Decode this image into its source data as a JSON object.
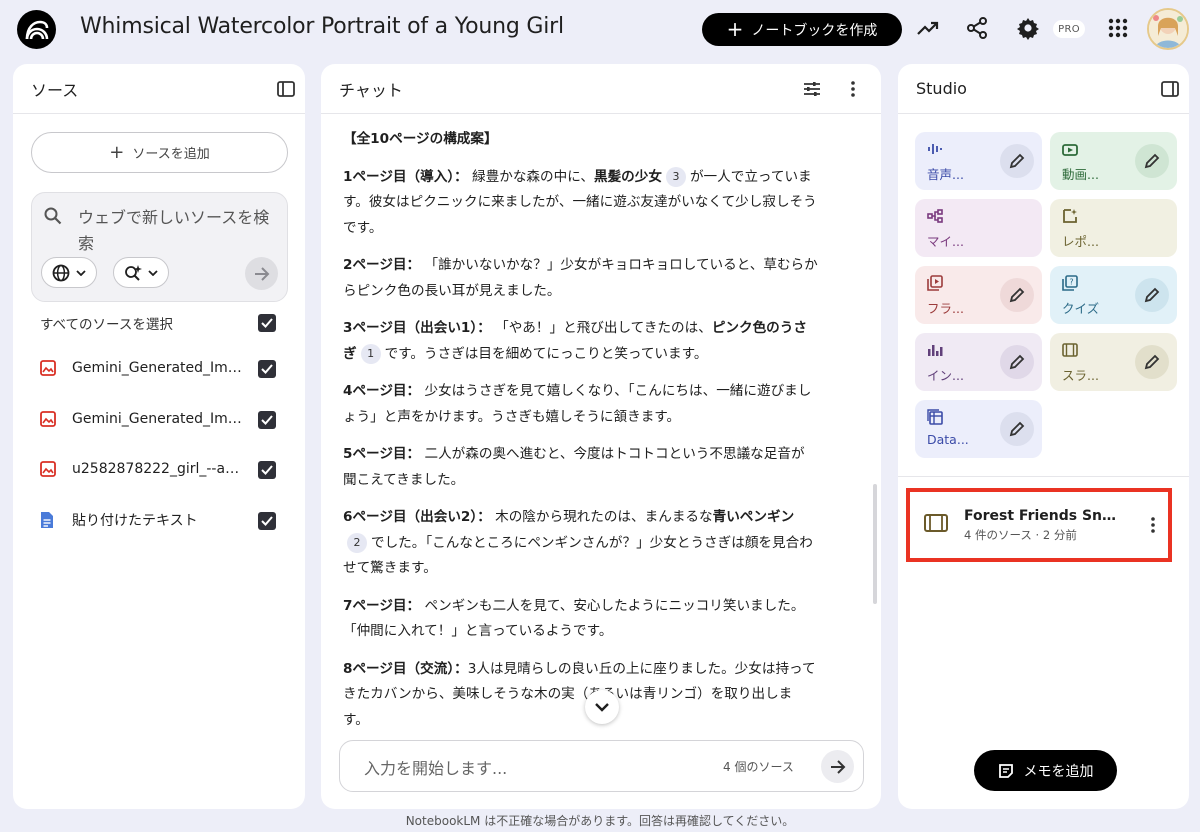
{
  "header": {
    "title": "Whimsical Watercolor Portrait of a Young Girl",
    "create_button": "ノートブックを作成",
    "pro_badge": "PRO"
  },
  "sources_panel": {
    "title": "ソース",
    "add_source": "ソースを追加",
    "search_placeholder": "ウェブで新しいソースを検索",
    "select_all": "すべてのソースを選択",
    "items": [
      {
        "label": "Gemini_Generated_Ima...",
        "icon": "image-icon",
        "checked": true
      },
      {
        "label": "Gemini_Generated_Ima...",
        "icon": "image-icon",
        "checked": true
      },
      {
        "label": "u2582878222_girl_--ar_2...",
        "icon": "image-icon",
        "checked": true
      },
      {
        "label": "貼り付けたテキスト",
        "icon": "document-icon",
        "checked": true
      }
    ]
  },
  "chat_panel": {
    "title": "チャット",
    "heading": "【全10ページの構成案】",
    "pages": [
      {
        "label": "1ページ目（導入）：",
        "pre": " 緑豊かな森の中に、",
        "bold": "黒髪の少女",
        "cite": "3",
        "post": "が一人で立っています。彼女はピクニックに来ましたが、一緒に遊ぶ友達がいなくて少し寂しそうです。"
      },
      {
        "label": "2ページ目：",
        "text": " 「誰かいないかな？」少女がキョロキョロしていると、草むらからピンク色の長い耳が見えました。"
      },
      {
        "label": "3ページ目（出会い1）：",
        "pre": " 「やあ！」と飛び出してきたのは、",
        "bold": "ピンク色のうさぎ",
        "cite": "1",
        "post": "です。うさぎは目を細めてにっこりと笑っています。"
      },
      {
        "label": "4ページ目：",
        "text": " 少女はうさぎを見て嬉しくなり、「こんにちは、一緒に遊びましょう」と声をかけます。うさぎも嬉しそうに頷きます。"
      },
      {
        "label": "5ページ目：",
        "text": " 二人が森の奥へ進むと、今度はトコトコという不思議な足音が聞こえてきました。"
      },
      {
        "label": "6ページ目（出会い2）：",
        "pre": " 木の陰から現れたのは、まんまるな",
        "bold": "青いペンギン",
        "cite": "2",
        "post": "でした。「こんなところにペンギンさんが？」少女とうさぎは顔を見合わせて驚きます。"
      },
      {
        "label": "7ページ目：",
        "text": " ペンギンも二人を見て、安心したようにニッコリ笑いました。「仲間に入れて！」と言っているようです。"
      },
      {
        "label": "8ページ目（交流）：",
        "text": "3人は見晴らしの良い丘の上に座りました。少女は持ってきたカバンから、美味しそうな木の実（あるいは青リンゴ）を取り出します。"
      }
    ],
    "input_placeholder": "入力を開始します...",
    "source_count": "4 個のソース"
  },
  "studio_panel": {
    "title": "Studio",
    "tiles": [
      {
        "label": "音声...",
        "icon": "audio-icon",
        "bg": "#eceefb",
        "fg": "#3b4ba8"
      },
      {
        "label": "動画...",
        "icon": "video-icon",
        "bg": "#e3f2e6",
        "fg": "#2e6b3a"
      },
      {
        "label": "マイ...",
        "icon": "mindmap-icon",
        "bg": "#f3e9f4",
        "fg": "#7a3a7e"
      },
      {
        "label": "レポ...",
        "icon": "report-icon",
        "bg": "#f1f0e2",
        "fg": "#6b6330"
      },
      {
        "label": "フラ...",
        "icon": "flashcard-icon",
        "bg": "#f9eaea",
        "fg": "#9c3b3b"
      },
      {
        "label": "クイズ",
        "icon": "quiz-icon",
        "bg": "#e1f1f8",
        "fg": "#2b6a87"
      },
      {
        "label": "イン...",
        "icon": "infographic-icon",
        "bg": "#f0eaf4",
        "fg": "#61407a"
      },
      {
        "label": "スラ...",
        "icon": "slides-icon",
        "bg": "#f1efe2",
        "fg": "#6b6330"
      },
      {
        "label": "Data...",
        "icon": "datatable-icon",
        "bg": "#eceefb",
        "fg": "#3b4ba8"
      }
    ],
    "note": {
      "title": "Forest Friends Snac...",
      "subtitle": "4 件のソース · 2 分前"
    },
    "add_memo": "メモを追加"
  },
  "footer": "NotebookLM は不正確な場合があります。回答は再確認してください。"
}
